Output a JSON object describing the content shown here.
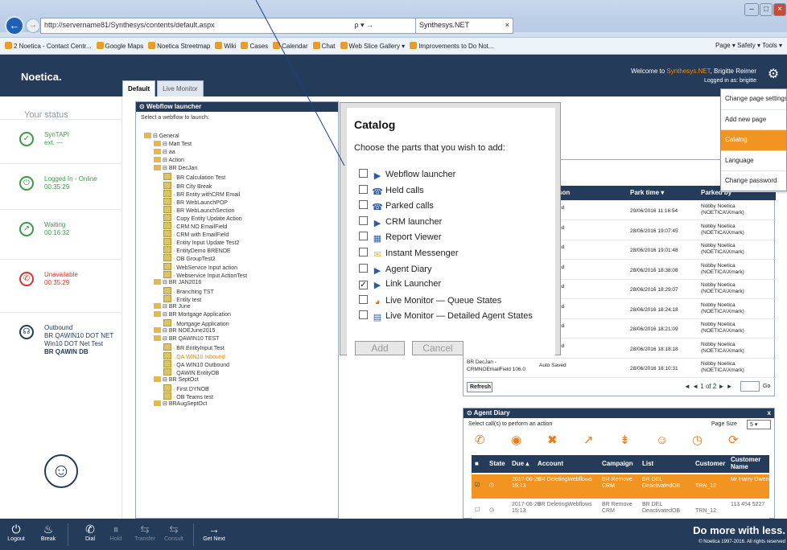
{
  "browser": {
    "url": "http://servername81/Synthesys/contents/default.aspx",
    "tab_title": "Synthesys.NET",
    "search_glyph": "ρ ▾ →",
    "favorites": [
      "2 Noetica - Contact Centr...",
      "Google Maps",
      "Noetica Streetmap",
      "Wiki",
      "Cases",
      "Calendar",
      "Chat",
      "Web Slice Gallery ▾",
      "Improvements to Do Not..."
    ],
    "tools": "Page ▾  Safety ▾  Tools ▾"
  },
  "app": {
    "logo": "Noetica.",
    "welcome_prefix": "Welcome to ",
    "welcome_brand": "Synthesys.NET",
    "welcome_user": ", Brigitte Reimer",
    "logged_in": "Logged in as: brigitte"
  },
  "tabs": [
    "Default",
    "Live Monitor"
  ],
  "sidebar": {
    "title": "Your status",
    "statuses": [
      {
        "line1": "SynTAPI",
        "line2": "ext. —",
        "color": "#3a9a45",
        "icon": "check-circle-icon",
        "glyph": "✓"
      },
      {
        "line1": "Logged In - Online",
        "line2": "00:35:29",
        "color": "#3a9a45",
        "icon": "lock-icon",
        "glyph": "⏻"
      },
      {
        "line1": "Waiting",
        "line2": "00:16:32",
        "color": "#3a9a45",
        "icon": "arrow-icon",
        "glyph": "↗"
      },
      {
        "line1": "Unavailable",
        "line2": "00:35:29",
        "color": "#d9342b",
        "icon": "phone-icon",
        "glyph": "✆"
      },
      {
        "line1": "Outbound",
        "line2": "BR QAWIN10 DOT NET",
        "line3": "Win10 DOT Net Test",
        "line4": "BR QAWIN DB",
        "color": "#253b5a",
        "icon": "headset-icon",
        "glyph": "☊"
      }
    ]
  },
  "webflow": {
    "title": "Webflow launcher",
    "subtitle": "Select a webflow to launch:",
    "tree": [
      {
        "t": "General",
        "l": 0,
        "f": 1
      },
      {
        "t": "Matt Test",
        "l": 1,
        "f": 1
      },
      {
        "t": "aa",
        "l": 1,
        "f": 1
      },
      {
        "t": "Action",
        "l": 1,
        "f": 1
      },
      {
        "t": "BR DecJan",
        "l": 1,
        "f": 1
      },
      {
        "t": "BR Calculation Test",
        "l": 2
      },
      {
        "t": "BR City Break",
        "l": 2
      },
      {
        "t": "BR Entity withCRM Email",
        "l": 2
      },
      {
        "t": "BR WebLaunchPOP",
        "l": 2
      },
      {
        "t": "BR WebLaunchSection",
        "l": 2
      },
      {
        "t": "Copy Entity Update Action",
        "l": 2
      },
      {
        "t": "CRM NO EmailField",
        "l": 2
      },
      {
        "t": "CRM with EmailField",
        "l": 2
      },
      {
        "t": "Entity Input Update Test2",
        "l": 2
      },
      {
        "t": "EntityDemo BRENDE",
        "l": 2
      },
      {
        "t": "OB GroupTest2",
        "l": 2
      },
      {
        "t": "WebService Input action",
        "l": 2
      },
      {
        "t": "Webservice Input ActionTest",
        "l": 2
      },
      {
        "t": "BR JAN2016",
        "l": 1,
        "f": 1
      },
      {
        "t": "Branching TST",
        "l": 2
      },
      {
        "t": "Entity test",
        "l": 2
      },
      {
        "t": "BR June",
        "l": 1,
        "f": 1
      },
      {
        "t": "BR Mortgage Application",
        "l": 1,
        "f": 1
      },
      {
        "t": "Mortgage Application",
        "l": 2
      },
      {
        "t": "BR NOEJune2015",
        "l": 1,
        "f": 1
      },
      {
        "t": "BR QAWIN10 TEST",
        "l": 1,
        "f": 1
      },
      {
        "t": "BR EntityInput Test",
        "l": 2
      },
      {
        "t": "QA WIN10 Inbound",
        "l": 2,
        "o": 1
      },
      {
        "t": "QA WIN10 Outbound",
        "l": 2
      },
      {
        "t": "QAWIN EntityOB",
        "l": 2
      },
      {
        "t": "BR SeptOct",
        "l": 1,
        "f": 1
      },
      {
        "t": "First DYNOB",
        "l": 2
      },
      {
        "t": "OB Teams test",
        "l": 2
      },
      {
        "t": "BRAugSeptOct",
        "l": 1,
        "f": 1
      }
    ]
  },
  "parked": {
    "col_reason": "son",
    "col_time": "Park time ▾",
    "col_by": "Parked by",
    "rows": [
      {
        "reason": "ed",
        "time": "29/06/2016 11:16:54",
        "by1": "Nobby Noetica",
        "by2": "(NOETICA\\Xmark)"
      },
      {
        "reason": "ed",
        "time": "28/06/2016 19:07:45",
        "by1": "Nobby Noetica",
        "by2": "(NOETICA\\Xmark)"
      },
      {
        "reason": "ed",
        "time": "28/06/2016 19:01:48",
        "by1": "Nobby Noetica",
        "by2": "(NOETICA\\Xmark)"
      },
      {
        "reason": "ed",
        "time": "28/06/2016 18:38:08",
        "by1": "Nobby Noetica",
        "by2": "(NOETICA\\Xmark)"
      },
      {
        "reason": "ed",
        "time": "28/06/2016 18:29:07",
        "by1": "Nobby Noetica",
        "by2": "(NOETICA\\Xmark)"
      },
      {
        "reason": "ed",
        "time": "28/06/2016 18:24:18",
        "by1": "Nobby Noetica",
        "by2": "(NOETICA\\Xmark)"
      },
      {
        "reason": "ed",
        "time": "28/06/2016 18:21:09",
        "by1": "Nobby Noetica",
        "by2": "(NOETICA\\Xmark)"
      },
      {
        "reason": "ed",
        "time": "28/06/2016 18:18:18",
        "by1": "Nobby Noetica",
        "by2": "(NOETICA\\Xmark)"
      },
      {
        "name1": "BR DecJan -",
        "name2": "CRMNOEmailField 106.0",
        "reason": "Auto Saved",
        "time": "28/06/2016 18:10:31",
        "by1": "Nobby Noetica",
        "by2": "(NOETICA\\Xmark)"
      }
    ],
    "refresh": "Refresh",
    "pager": "◄ ◄ 1 of 2 ► ►",
    "go": "Go"
  },
  "diary": {
    "title": "Agent Diary",
    "subtitle": "Select call(s) to perform an action",
    "page_size_label": "Page Size",
    "page_size": "5",
    "close": "x",
    "action_icons": [
      "phone-icon",
      "target-icon",
      "cancel-icon",
      "reassign-icon",
      "split-icon",
      "user-icon",
      "clock-icon",
      "refresh-icon"
    ],
    "action_glyphs": [
      "✆",
      "◉",
      "✖",
      "↗",
      "⇟",
      "☺",
      "◷",
      "⟳"
    ],
    "headers": [
      "State",
      "Due ▴",
      "Account",
      "Campaign",
      "List",
      "Customer",
      "Customer Name"
    ],
    "rows": [
      {
        "due": "2017-06-20 15:13",
        "account": "BR DeletingWebflows",
        "campaign": "BR Remove CRM",
        "list": "BR DEL DeactivatedOB",
        "customer": "TRN_12",
        "name": "Mr Harry Owen",
        "selected": true
      },
      {
        "due": "2017-06-20 15:13",
        "account": "BR DeletingWebflows",
        "campaign": "BR Remove CRM",
        "list": "BR DEL DeactivatedOB",
        "customer": "TRN_12",
        "name": "113 454 5227",
        "selected": false
      }
    ]
  },
  "menu": [
    "Change page settings",
    "Add new page",
    "Catalog",
    "Language",
    "Change password"
  ],
  "catalog": {
    "title": "Catalog",
    "subtitle": "Choose the parts that you wish to add:",
    "items": [
      {
        "label": "Webflow launcher",
        "checked": false,
        "icon": "play-circle-icon",
        "glyph": "▶"
      },
      {
        "label": "Held calls",
        "checked": false,
        "icon": "held-calls-icon",
        "glyph": "☎"
      },
      {
        "label": "Parked calls",
        "checked": false,
        "icon": "parked-calls-icon",
        "glyph": "☎"
      },
      {
        "label": "CRM launcher",
        "checked": false,
        "icon": "play-circle-icon",
        "glyph": "▶"
      },
      {
        "label": "Report Viewer",
        "checked": false,
        "icon": "report-icon",
        "glyph": "▦"
      },
      {
        "label": "Instant Messenger",
        "checked": false,
        "icon": "envelope-icon",
        "glyph": "✉"
      },
      {
        "label": "Agent Diary",
        "checked": false,
        "icon": "play-circle-icon",
        "glyph": "▶"
      },
      {
        "label": "Link Launcher",
        "checked": true,
        "icon": "play-circle-icon",
        "glyph": "▶"
      },
      {
        "label": "Live Monitor — Queue States",
        "checked": false,
        "icon": "pie-chart-icon",
        "glyph": "◕"
      },
      {
        "label": "Live Monitor — Detailed Agent States",
        "checked": false,
        "icon": "table-icon",
        "glyph": "▤"
      }
    ],
    "add": "Add",
    "cancel": "Cancel"
  },
  "toolbar": {
    "buttons": [
      {
        "label": "Logout",
        "glyph": "⏻",
        "icon": "power-icon",
        "dim": false
      },
      {
        "label": "Break",
        "glyph": "♨",
        "icon": "coffee-icon",
        "dim": false
      },
      {
        "label": "Dial",
        "glyph": "✆",
        "icon": "phone-icon",
        "dim": false
      },
      {
        "label": "Hold",
        "glyph": "⏸",
        "icon": "pause-icon",
        "dim": true
      },
      {
        "label": "Transfer",
        "glyph": "⇆",
        "icon": "transfer-icon",
        "dim": true
      },
      {
        "label": "Consult",
        "glyph": "⇆",
        "icon": "consult-icon",
        "dim": true
      },
      {
        "label": "Get Next",
        "glyph": "→",
        "icon": "arrow-right-icon",
        "dim": false
      }
    ],
    "tagline": "Do more with less.",
    "copyright": "© Noetica 1997-2016. All rights reserved"
  }
}
